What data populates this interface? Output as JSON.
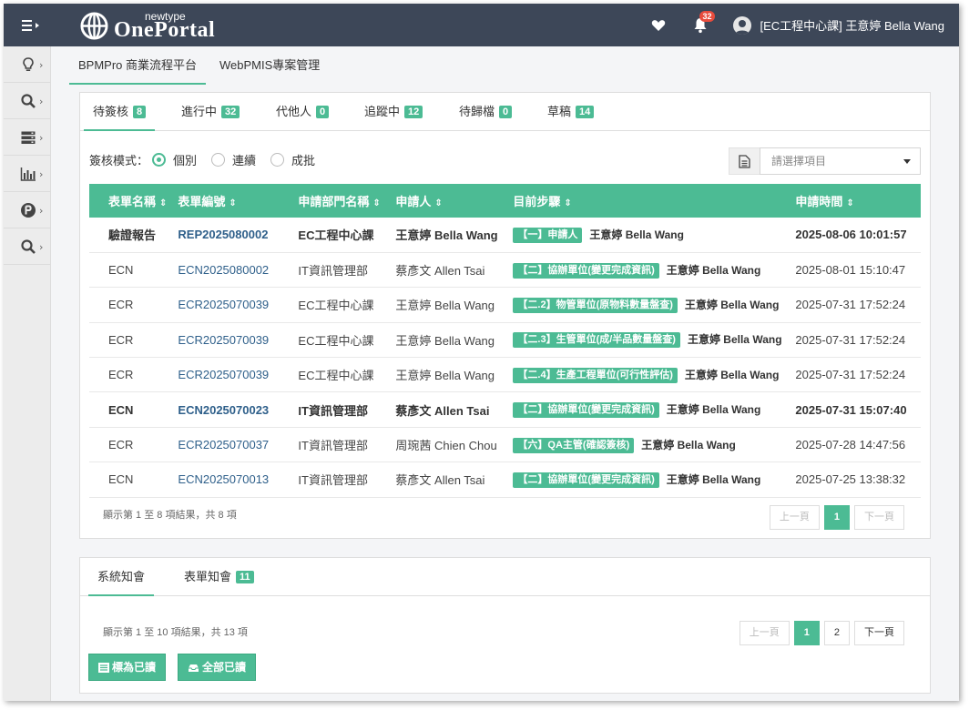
{
  "header": {
    "brand_small": "newtype",
    "brand_big": "OnePortal",
    "notification_count": "32",
    "user": "[EC工程中心課] 王意婷 Bella Wang"
  },
  "sidebar": {
    "items": [
      {
        "icon": "lightbulb-icon"
      },
      {
        "icon": "search-icon"
      },
      {
        "icon": "server-icon"
      },
      {
        "icon": "bar-chart-icon"
      },
      {
        "icon": "p-circle-icon"
      },
      {
        "icon": "search-icon"
      }
    ]
  },
  "nav": {
    "tabs": [
      "BPMPro 商業流程平台",
      "WebPMIS專案管理"
    ]
  },
  "panel1": {
    "tabs": [
      {
        "label": "待簽核",
        "count": "8"
      },
      {
        "label": "進行中",
        "count": "32"
      },
      {
        "label": "代他人",
        "count": "0"
      },
      {
        "label": "追蹤中",
        "count": "12"
      },
      {
        "label": "待歸檔",
        "count": "0"
      },
      {
        "label": "草稿",
        "count": "14"
      }
    ],
    "mode_label": "簽核模式：",
    "modes": [
      "個別",
      "連續",
      "成批"
    ],
    "select_placeholder": "請選擇項目",
    "columns": [
      "表單名稱",
      "表單編號",
      "申請部門名稱",
      "申請人",
      "目前步驟",
      "申請時間"
    ],
    "rows": [
      {
        "form": "驗證報告",
        "id": "REP2025080002",
        "dept": "EC工程中心課",
        "applicant": "王意婷 Bella Wang",
        "step": "【一】申請人",
        "step_user": "王意婷 Bella Wang",
        "time": "2025-08-06 10:01:57",
        "bold": true
      },
      {
        "form": "ECN",
        "id": "ECN2025080002",
        "dept": "IT資訊管理部",
        "applicant": "蔡彥文 Allen Tsai",
        "step": "【二】協辦單位(變更完成資訊)",
        "step_user": "王意婷 Bella Wang",
        "time": "2025-08-01 15:10:47",
        "bold": false
      },
      {
        "form": "ECR",
        "id": "ECR2025070039",
        "dept": "EC工程中心課",
        "applicant": "王意婷 Bella Wang",
        "step": "【二.2】物管單位(原物料數量盤查)",
        "step_user": "王意婷 Bella Wang",
        "time": "2025-07-31 17:52:24",
        "bold": false
      },
      {
        "form": "ECR",
        "id": "ECR2025070039",
        "dept": "EC工程中心課",
        "applicant": "王意婷 Bella Wang",
        "step": "【二.3】生管單位(成/半品數量盤查)",
        "step_user": "王意婷 Bella Wang",
        "time": "2025-07-31 17:52:24",
        "bold": false
      },
      {
        "form": "ECR",
        "id": "ECR2025070039",
        "dept": "EC工程中心課",
        "applicant": "王意婷 Bella Wang",
        "step": "【二.4】生產工程單位(可行性評估)",
        "step_user": "王意婷 Bella Wang",
        "time": "2025-07-31 17:52:24",
        "bold": false
      },
      {
        "form": "ECN",
        "id": "ECN2025070023",
        "dept": "IT資訊管理部",
        "applicant": "蔡彥文 Allen Tsai",
        "step": "【二】協辦單位(變更完成資訊)",
        "step_user": "王意婷 Bella Wang",
        "time": "2025-07-31 15:07:40",
        "bold": true
      },
      {
        "form": "ECR",
        "id": "ECR2025070037",
        "dept": "IT資訊管理部",
        "applicant": "周琬茜 Chien Chou",
        "step": "【六】QA主管(確認簽核)",
        "step_user": "王意婷 Bella Wang",
        "time": "2025-07-28 14:47:56",
        "bold": false
      },
      {
        "form": "ECN",
        "id": "ECN2025070013",
        "dept": "IT資訊管理部",
        "applicant": "蔡彥文 Allen Tsai",
        "step": "【二】協辦單位(變更完成資訊)",
        "step_user": "王意婷 Bella Wang",
        "time": "2025-07-25 13:38:32",
        "bold": false
      }
    ],
    "info": "顯示第 1 至 8 項結果，共 8 項",
    "prev": "上一頁",
    "page": "1",
    "next": "下一頁"
  },
  "panel2": {
    "tabs": [
      {
        "label": "系統知會",
        "count": ""
      },
      {
        "label": "表單知會",
        "count": "11"
      }
    ],
    "info": "顯示第 1 至 10 項結果，共 13 項",
    "prev": "上一頁",
    "pages": [
      "1",
      "2"
    ],
    "next": "下一頁",
    "mark_read": "標為已讀",
    "all_read": "全部已讀"
  },
  "colors": {
    "topbar": "#3d4758",
    "accent": "#4cbb94",
    "badge_red": "#e84c3d",
    "link": "#2e5f8a"
  }
}
